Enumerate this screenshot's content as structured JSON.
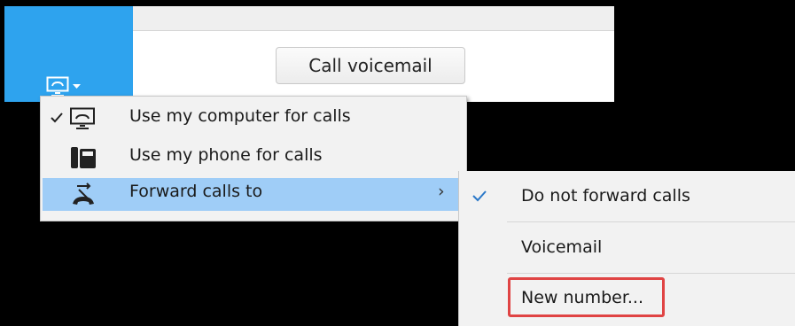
{
  "colors": {
    "accent": "#2ea3ee",
    "menu_highlight": "#9fcdf7",
    "callout_border": "#e04444"
  },
  "header": {
    "device_icon": "monitor-phone-icon",
    "dropdown_icon": "caret-down-icon"
  },
  "main": {
    "call_voicemail_label": "Call voicemail"
  },
  "device_menu": {
    "items": [
      {
        "label": "Use my computer for calls",
        "icon": "monitor-phone-icon",
        "checked": true
      },
      {
        "label": "Use my phone for calls",
        "icon": "desk-phone-icon",
        "checked": false
      },
      {
        "label": "Forward calls to",
        "icon": "forward-call-icon",
        "checked": false,
        "submenu_arrow": "›",
        "highlighted": true
      }
    ]
  },
  "forward_submenu": {
    "items": [
      {
        "label": "Do not forward calls",
        "checked": true
      },
      {
        "label": "Voicemail",
        "checked": false
      },
      {
        "label": "New number...",
        "checked": false,
        "callout": true
      }
    ]
  }
}
